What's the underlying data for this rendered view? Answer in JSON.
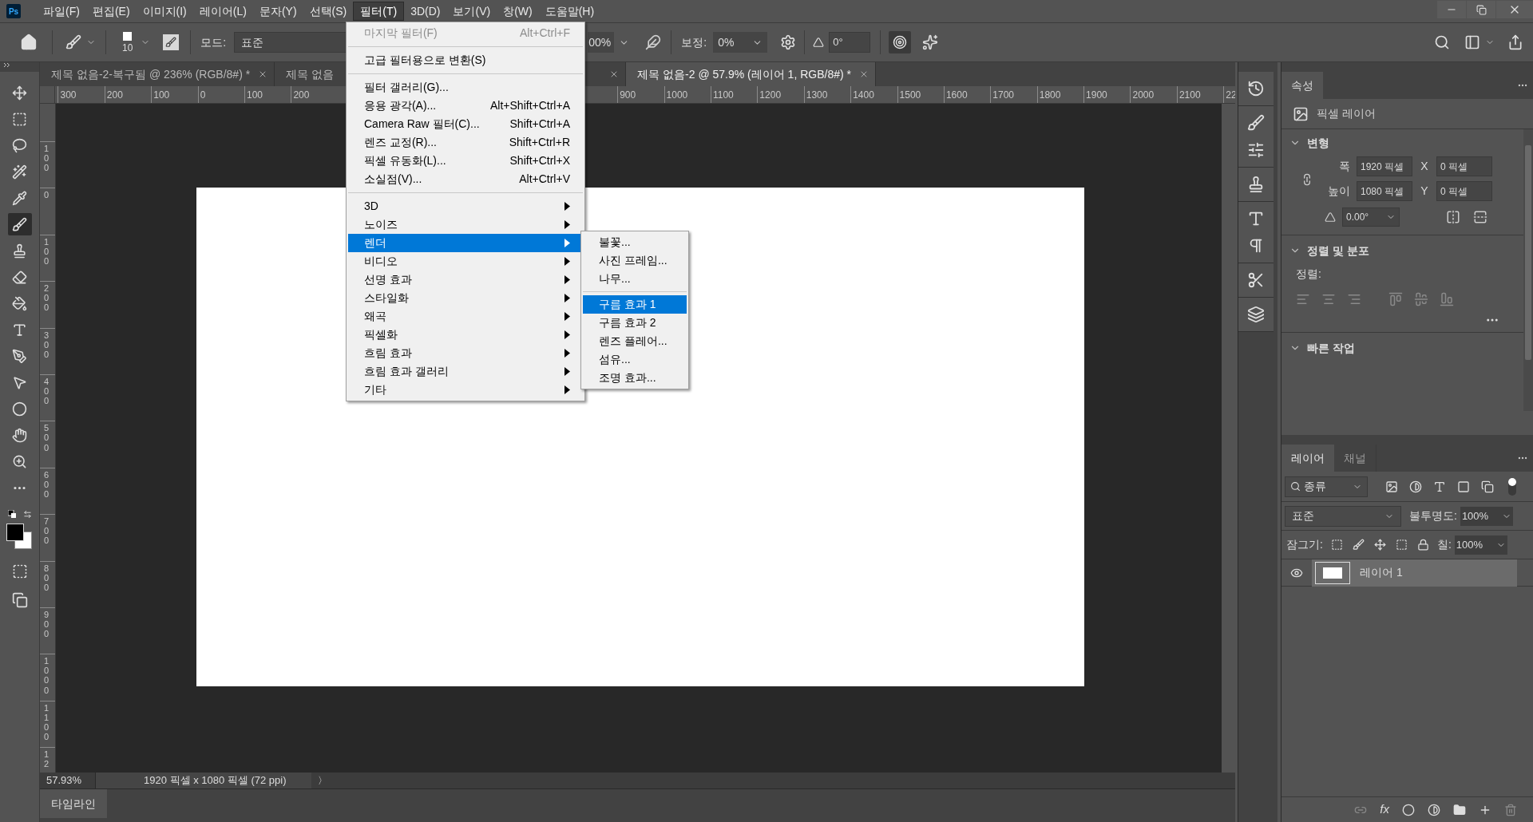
{
  "app_logo": "Ps",
  "menu_bar": [
    {
      "label": "파일(F)",
      "selected": false
    },
    {
      "label": "편집(E)",
      "selected": false
    },
    {
      "label": "이미지(I)",
      "selected": false
    },
    {
      "label": "레이어(L)",
      "selected": false
    },
    {
      "label": "문자(Y)",
      "selected": false
    },
    {
      "label": "선택(S)",
      "selected": false
    },
    {
      "label": "필터(T)",
      "selected": true
    },
    {
      "label": "3D(D)",
      "selected": false
    },
    {
      "label": "보기(V)",
      "selected": false
    },
    {
      "label": "창(W)",
      "selected": false
    },
    {
      "label": "도움말(H)",
      "selected": false
    }
  ],
  "options_bar": {
    "brush_size": "10",
    "mode_label": "모드:",
    "mode_value": "표준",
    "opacity_value": "00%",
    "smoothing_label": "보정:",
    "smoothing_value": "0%",
    "angle_value": "0°"
  },
  "document_tabs": [
    {
      "title": "제목 없음-2-복구됨 @ 236% (RGB/8#) *",
      "selected": false
    },
    {
      "title": "제목 없음",
      "selected": false
    },
    {
      "title": "제목 없음-2 @ 57.9% (레이어 1, RGB/8#) *",
      "selected": true
    }
  ],
  "ruler": {
    "top_left_labels": [
      "300",
      "200",
      "100",
      "0",
      "100",
      "200"
    ],
    "top_right_labels": [
      "900",
      "1000",
      "1100",
      "1200",
      "1300",
      "1400",
      "1500",
      "1600",
      "1700",
      "1800",
      "1900",
      "2000",
      "2100",
      "22"
    ],
    "left_labels": [
      "100",
      "0",
      "100",
      "200",
      "300",
      "400",
      "500",
      "600",
      "700",
      "800",
      "900",
      "1000",
      "1100",
      "12"
    ]
  },
  "tools": [
    {
      "kind": "move",
      "selected": false
    },
    {
      "kind": "marquee",
      "selected": false
    },
    {
      "kind": "lasso",
      "selected": false
    },
    {
      "kind": "wand",
      "selected": false
    },
    {
      "kind": "eyedropper",
      "selected": false
    },
    {
      "kind": "brush",
      "selected": true
    },
    {
      "kind": "stamp",
      "selected": false
    },
    {
      "kind": "eraser",
      "selected": false
    },
    {
      "kind": "bucket",
      "selected": false
    },
    {
      "kind": "type",
      "selected": false
    },
    {
      "kind": "pen",
      "selected": false
    },
    {
      "kind": "pointer",
      "selected": false
    },
    {
      "kind": "ellipse",
      "selected": false
    },
    {
      "kind": "hand",
      "selected": false
    },
    {
      "kind": "zoom",
      "selected": false
    },
    {
      "kind": "more",
      "selected": false
    }
  ],
  "filter_menu": [
    {
      "kind": "item",
      "label": "마지막 필터(F)",
      "shortcut": "Alt+Ctrl+F",
      "disabled": true,
      "selected": false
    },
    {
      "kind": "separator"
    },
    {
      "kind": "item",
      "label": "고급 필터용으로 변환(S)",
      "disabled": false,
      "selected": false
    },
    {
      "kind": "separator"
    },
    {
      "kind": "item",
      "label": "필터 갤러리(G)...",
      "disabled": false,
      "selected": false
    },
    {
      "kind": "item",
      "label": "응용 광각(A)...",
      "shortcut": "Alt+Shift+Ctrl+A",
      "disabled": false,
      "selected": false
    },
    {
      "kind": "item",
      "label": "Camera Raw 필터(C)...",
      "shortcut": "Shift+Ctrl+A",
      "disabled": false,
      "selected": false
    },
    {
      "kind": "item",
      "label": "렌즈 교정(R)...",
      "shortcut": "Shift+Ctrl+R",
      "disabled": false,
      "selected": false
    },
    {
      "kind": "item",
      "label": "픽셀 유동화(L)...",
      "shortcut": "Shift+Ctrl+X",
      "disabled": false,
      "selected": false
    },
    {
      "kind": "item",
      "label": "소실점(V)...",
      "shortcut": "Alt+Ctrl+V",
      "disabled": false,
      "selected": false
    },
    {
      "kind": "separator"
    },
    {
      "kind": "submenu",
      "label": "3D",
      "disabled": false,
      "selected": false
    },
    {
      "kind": "submenu",
      "label": "노이즈",
      "disabled": false,
      "selected": false
    },
    {
      "kind": "submenu",
      "label": "렌더",
      "disabled": false,
      "selected": true
    },
    {
      "kind": "submenu",
      "label": "비디오",
      "disabled": false,
      "selected": false
    },
    {
      "kind": "submenu",
      "label": "선명 효과",
      "disabled": false,
      "selected": false
    },
    {
      "kind": "submenu",
      "label": "스타일화",
      "disabled": false,
      "selected": false
    },
    {
      "kind": "submenu",
      "label": "왜곡",
      "disabled": false,
      "selected": false
    },
    {
      "kind": "submenu",
      "label": "픽셀화",
      "disabled": false,
      "selected": false
    },
    {
      "kind": "submenu",
      "label": "흐림 효과",
      "disabled": false,
      "selected": false
    },
    {
      "kind": "submenu",
      "label": "흐림 효과 갤러리",
      "disabled": false,
      "selected": false
    },
    {
      "kind": "submenu",
      "label": "기타",
      "disabled": false,
      "selected": false
    }
  ],
  "render_submenu": [
    {
      "kind": "item",
      "label": "불꽃...",
      "selected": false
    },
    {
      "kind": "item",
      "label": "사진 프레임...",
      "selected": false
    },
    {
      "kind": "item",
      "label": "나무...",
      "selected": false
    },
    {
      "kind": "separator"
    },
    {
      "kind": "item",
      "label": "구름 효과 1",
      "selected": true
    },
    {
      "kind": "item",
      "label": "구름 효과 2",
      "selected": false
    },
    {
      "kind": "item",
      "label": "렌즈 플레어...",
      "selected": false
    },
    {
      "kind": "item",
      "label": "섬유...",
      "selected": false
    },
    {
      "kind": "item",
      "label": "조명 효과...",
      "selected": false
    }
  ],
  "status_bar": {
    "zoom": "57.93%",
    "doc_info": "1920 픽셀 x 1080 픽셀 (72 ppi)",
    "arrow": "〉"
  },
  "timeline_tab": "타임라인",
  "properties_panel": {
    "tab": "속성",
    "layer_type": "픽셀 레이어",
    "transform": {
      "title": "변형",
      "expanded": true,
      "width_label": "폭",
      "width_value": "1920 픽셀",
      "x_label": "X",
      "x_value": "0 픽셀",
      "height_label": "높이",
      "height_value": "1080 픽셀",
      "y_label": "Y",
      "y_value": "0 픽셀",
      "angle_value": "0.00°"
    },
    "align": {
      "title": "정렬 및 분포",
      "expanded": true,
      "align_label": "정렬:"
    },
    "quick_actions": {
      "title": "빠른 작업",
      "expanded": true
    }
  },
  "layers_panel": {
    "tabs": [
      {
        "label": "레이어",
        "selected": true
      },
      {
        "label": "채널",
        "selected": false
      }
    ],
    "filter_kind": "종류",
    "blend_mode": "표준",
    "opacity_label": "불투명도:",
    "opacity_value": "100%",
    "lock_label": "잠그기:",
    "fill_label": "칠:",
    "fill_value": "100%",
    "fx_button": "fx",
    "layers": [
      {
        "name": "레이어 1",
        "visible": true,
        "selected": true
      }
    ]
  }
}
